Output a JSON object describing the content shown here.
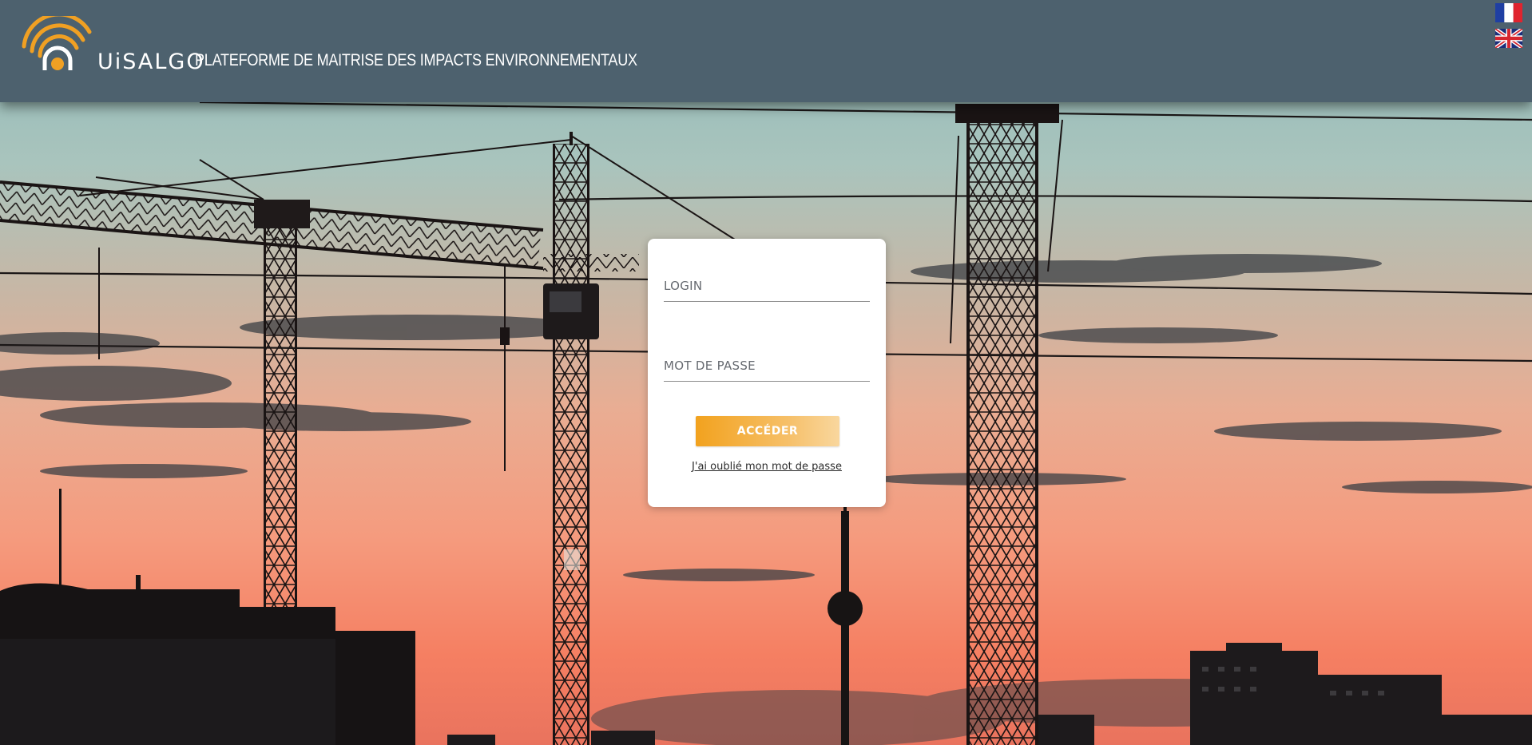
{
  "header": {
    "logo_text": "UiSALGO",
    "platform_title": "PLATEFORME DE MAITRISE DES IMPACTS ENVIRONNEMENTAUX"
  },
  "languages": [
    {
      "code": "fr",
      "icon": "flag-fr-icon"
    },
    {
      "code": "en",
      "icon": "flag-uk-icon"
    }
  ],
  "login_form": {
    "login_placeholder": "LOGIN",
    "password_placeholder": "MOT DE PASSE",
    "submit_label": "ACCÉDER",
    "forgot_password_link": "J'ai oublié mon mot de passe"
  },
  "colors": {
    "header_bg": "#4d616e",
    "accent": "#f2a21e",
    "sky_top": "#9cc3c0",
    "sky_bottom": "#f4866a"
  }
}
